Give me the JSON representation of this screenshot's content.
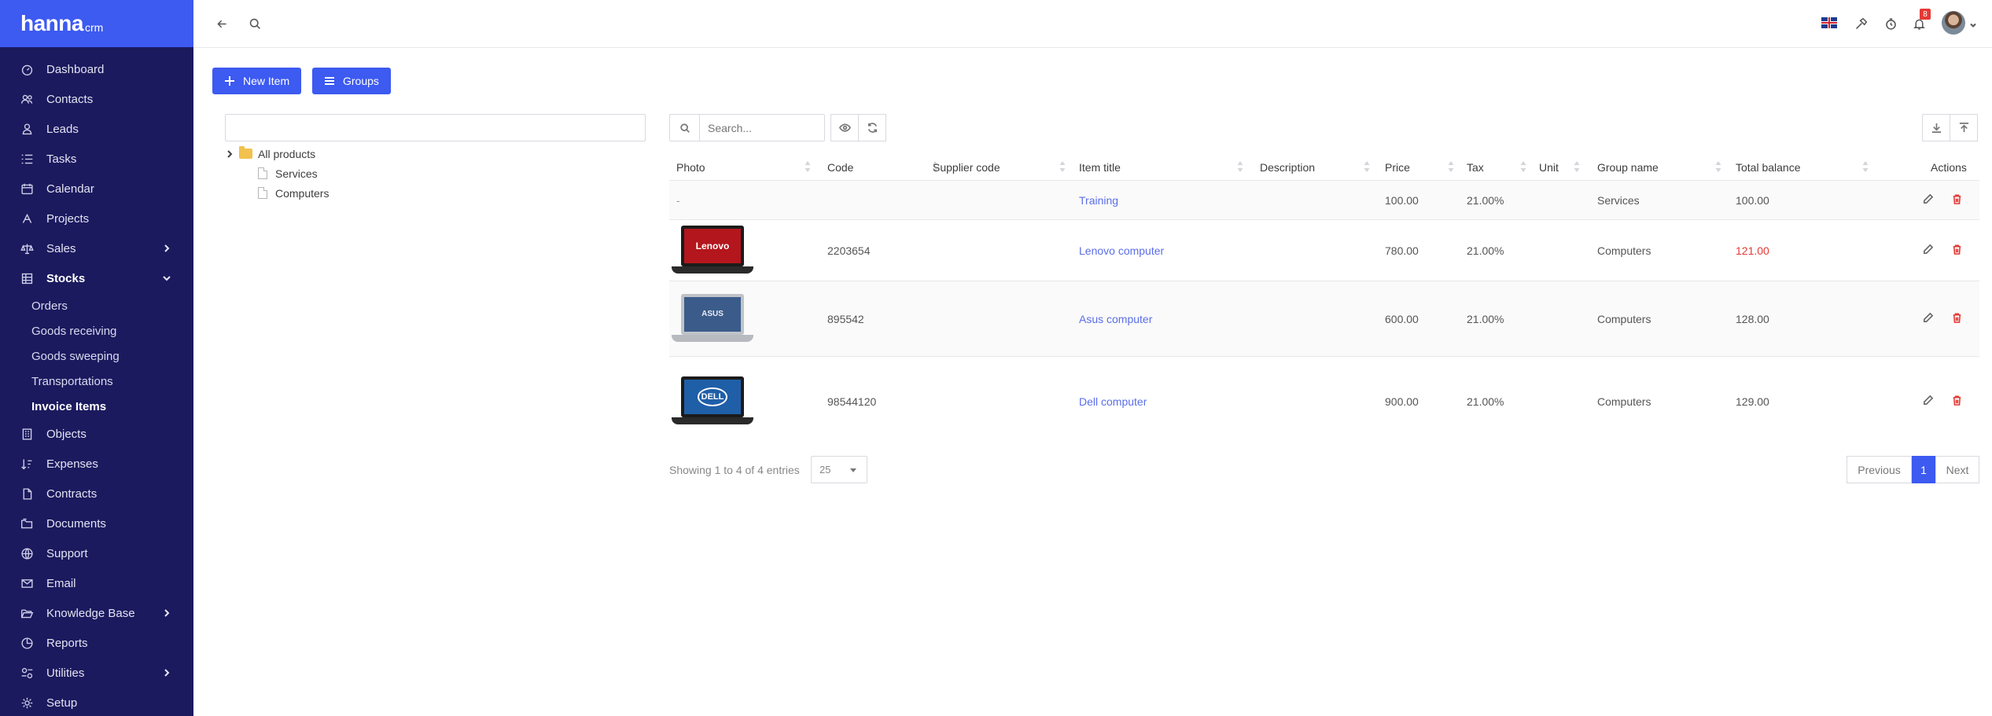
{
  "brand": {
    "name": "hanna",
    "suffix": "crm"
  },
  "sidebar": {
    "items": [
      {
        "label": "Dashboard",
        "icon": "dashboard-icon"
      },
      {
        "label": "Contacts",
        "icon": "contacts-icon"
      },
      {
        "label": "Leads",
        "icon": "leads-icon"
      },
      {
        "label": "Tasks",
        "icon": "tasks-icon"
      },
      {
        "label": "Calendar",
        "icon": "calendar-icon"
      },
      {
        "label": "Projects",
        "icon": "projects-icon"
      },
      {
        "label": "Sales",
        "icon": "scale-icon"
      },
      {
        "label": "Stocks",
        "icon": "stocks-icon"
      },
      {
        "label": "Objects",
        "icon": "building-icon"
      },
      {
        "label": "Expenses",
        "icon": "expenses-icon"
      },
      {
        "label": "Contracts",
        "icon": "document-icon"
      },
      {
        "label": "Documents",
        "icon": "folder-icon"
      },
      {
        "label": "Support",
        "icon": "globe-icon"
      },
      {
        "label": "Email",
        "icon": "mail-icon"
      },
      {
        "label": "Knowledge Base",
        "icon": "folder-open-icon"
      },
      {
        "label": "Reports",
        "icon": "pie-chart-icon"
      },
      {
        "label": "Utilities",
        "icon": "utilities-icon"
      },
      {
        "label": "Setup",
        "icon": "gear-icon"
      }
    ],
    "stocks_sub": [
      "Orders",
      "Goods receiving",
      "Goods sweeping",
      "Transportations",
      "Invoice Items"
    ]
  },
  "topbar": {
    "notifications_count": "8",
    "language": "en-gb-flag-icon"
  },
  "actions": {
    "new_item": "New Item",
    "groups": "Groups"
  },
  "tree": {
    "root": "All products",
    "children": [
      "Services",
      "Computers"
    ]
  },
  "table": {
    "search_placeholder": "Search...",
    "columns": [
      "Photo",
      "Code",
      "Supplier code",
      "Item title",
      "Description",
      "Price",
      "Tax",
      "Unit",
      "Group name",
      "Total balance",
      "Actions"
    ],
    "rows": [
      {
        "photo": "-",
        "code": "",
        "supplier_code": "",
        "title": "Training",
        "description": "",
        "price": "100.00",
        "tax": "21.00%",
        "unit": "",
        "group": "Services",
        "balance": "100.00",
        "balance_negative": false
      },
      {
        "photo": "Lenovo",
        "code": "2203654",
        "supplier_code": "",
        "title": "Lenovo computer",
        "description": "",
        "price": "780.00",
        "tax": "21.00%",
        "unit": "",
        "group": "Computers",
        "balance": "121.00",
        "balance_negative": true
      },
      {
        "photo": "ASUS",
        "code": "895542",
        "supplier_code": "",
        "title": "Asus computer",
        "description": "",
        "price": "600.00",
        "tax": "21.00%",
        "unit": "",
        "group": "Computers",
        "balance": "128.00",
        "balance_negative": false
      },
      {
        "photo": "DELL",
        "code": "98544120",
        "supplier_code": "",
        "title": "Dell computer",
        "description": "",
        "price": "900.00",
        "tax": "21.00%",
        "unit": "",
        "group": "Computers",
        "balance": "129.00",
        "balance_negative": false
      }
    ]
  },
  "footer": {
    "showing": "Showing 1 to 4 of 4 entries",
    "page_size": "25",
    "previous": "Previous",
    "current_page": "1",
    "next": "Next"
  },
  "colors": {
    "accent": "#3d5af1",
    "sidebar": "#1c1a5e",
    "link": "#5b6ee8",
    "danger": "#e53935"
  }
}
